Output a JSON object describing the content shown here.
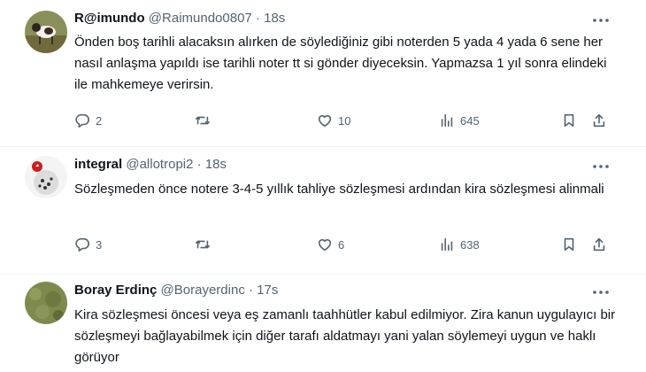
{
  "tweets": [
    {
      "name": "R@imundo",
      "handle": "@Raimundo0807",
      "dot": "·",
      "time": "18s",
      "text": "Önden boş tarihli alacaksın alırken de söylediğiniz gibi noterden 5 yada 4 yada 6 sene her nasıl anlaşma yapıldı ise tarihli noter tt si gönder diyeceksin. Yapmazsa 1 yıl sonra elindeki ile mahkemeye verirsin.",
      "replies": "2",
      "retweets": "",
      "likes": "10",
      "views": "645"
    },
    {
      "name": "integral",
      "handle": "@allotropi2",
      "dot": "·",
      "time": "18s",
      "text": "Sözleşmeden önce notere 3-4-5 yıllık tahliye sözleşmesi ardından kira sözleşmesi alinmali",
      "replies": "3",
      "retweets": "",
      "likes": "6",
      "views": "638"
    },
    {
      "name": "Boray Erdinç",
      "handle": "@Borayerdinc",
      "dot": "·",
      "time": "17s",
      "text": "Kira sözleşmesi öncesi veya eş zamanlı taahhütler kabul edilmiyor. Zira kanun uygulayıcı bir sözleşmeyi bağlayabilmek için diğer tarafı aldatmayı yani yalan söylemeyi uygun ve haklı görüyor"
    }
  ],
  "colors": {
    "text": "#0f1419",
    "muted": "#536471",
    "divider": "#eff3f4"
  },
  "icons": [
    "reply-icon",
    "retweet-icon",
    "like-icon",
    "views-icon",
    "bookmark-icon",
    "share-icon",
    "more-icon"
  ]
}
